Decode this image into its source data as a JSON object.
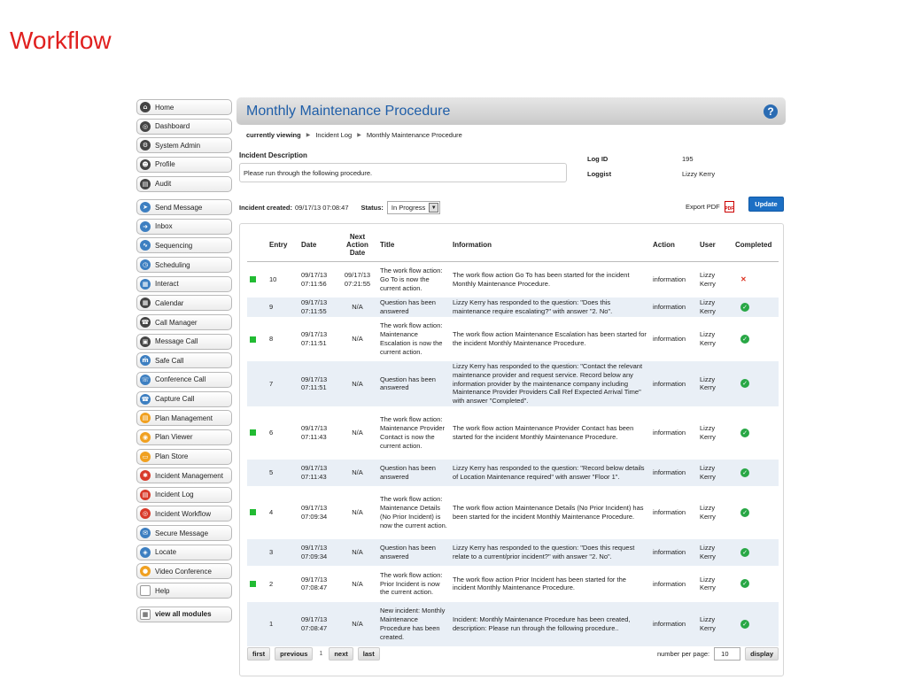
{
  "slide_title": "Workflow",
  "sidebar": {
    "group1": [
      {
        "label": "Home",
        "icon": "home-icon",
        "color": "dark",
        "glyph": "⌂"
      },
      {
        "label": "Dashboard",
        "icon": "dashboard-icon",
        "color": "dark",
        "glyph": "◎"
      },
      {
        "label": "System Admin",
        "icon": "gear-icon",
        "color": "dark",
        "glyph": "⚙"
      },
      {
        "label": "Profile",
        "icon": "user-icon",
        "color": "dark",
        "glyph": "☻"
      },
      {
        "label": "Audit",
        "icon": "audit-icon",
        "color": "dark",
        "glyph": "▤"
      }
    ],
    "group2": [
      {
        "label": "Send Message",
        "icon": "send-icon",
        "color": "blue",
        "glyph": "➤"
      },
      {
        "label": "Inbox",
        "icon": "inbox-icon",
        "color": "blue",
        "glyph": "➜"
      },
      {
        "label": "Sequencing",
        "icon": "sequencing-icon",
        "color": "blue",
        "glyph": "∿"
      },
      {
        "label": "Scheduling",
        "icon": "clock-icon",
        "color": "blue",
        "glyph": "◷"
      },
      {
        "label": "Interact",
        "icon": "interact-icon",
        "color": "blue",
        "glyph": "▦"
      },
      {
        "label": "Calendar",
        "icon": "calendar-icon",
        "color": "dark",
        "glyph": "▦"
      },
      {
        "label": "Call Manager",
        "icon": "phone-icon",
        "color": "dark",
        "glyph": "☎"
      },
      {
        "label": "Message Call",
        "icon": "message-call-icon",
        "color": "dark",
        "glyph": "▣"
      },
      {
        "label": "Safe Call",
        "icon": "safe-call-icon",
        "color": "blue",
        "glyph": "ṁ"
      },
      {
        "label": "Conference Call",
        "icon": "conference-icon",
        "color": "blue",
        "glyph": "☏"
      },
      {
        "label": "Capture Call",
        "icon": "capture-icon",
        "color": "blue",
        "glyph": "☎"
      },
      {
        "label": "Plan Management",
        "icon": "plan-management-icon",
        "color": "orange",
        "glyph": "▤"
      },
      {
        "label": "Plan Viewer",
        "icon": "plan-viewer-icon",
        "color": "orange",
        "glyph": "◉"
      },
      {
        "label": "Plan Store",
        "icon": "plan-store-icon",
        "color": "orange",
        "glyph": "▭"
      },
      {
        "label": "Incident Management",
        "icon": "incident-management-icon",
        "color": "red",
        "glyph": "✱"
      },
      {
        "label": "Incident Log",
        "icon": "incident-log-icon",
        "color": "red",
        "glyph": "▤"
      },
      {
        "label": "Incident Workflow",
        "icon": "incident-workflow-icon",
        "color": "red",
        "glyph": "◎"
      },
      {
        "label": "Secure Message",
        "icon": "secure-message-icon",
        "color": "blue",
        "glyph": "✉"
      },
      {
        "label": "Locate",
        "icon": "locate-icon",
        "color": "blue",
        "glyph": "◈"
      },
      {
        "label": "Video Conference",
        "icon": "video-conference-icon",
        "color": "orange",
        "glyph": "●"
      },
      {
        "label": "Help",
        "icon": "help-square-icon",
        "color": "white",
        "glyph": ""
      }
    ],
    "view_all": "view all modules"
  },
  "header": {
    "title": "Monthly Maintenance Procedure",
    "help_glyph": "?"
  },
  "breadcrumb": {
    "prefix": "currently viewing",
    "items": [
      "Incident Log",
      "Monthly Maintenance Procedure"
    ]
  },
  "incident": {
    "desc_label": "Incident Description",
    "desc_value": "Please run through the following procedure.",
    "log_id_label": "Log ID",
    "log_id_value": "195",
    "loggist_label": "Loggist",
    "loggist_value": "Lizzy Kerry",
    "created_label": "Incident created:",
    "created_value": "09/17/13 07:08:47",
    "status_label": "Status:",
    "status_value": "In Progress",
    "export_label": "Export PDF",
    "update_label": "Update"
  },
  "table": {
    "headers": [
      "",
      "Entry",
      "Date",
      "Next Action Date",
      "Title",
      "Information",
      "Action",
      "User",
      "Completed"
    ],
    "rows": [
      {
        "flag": true,
        "entry": "10",
        "date": "09/17/13 07:11:56",
        "next": "09/17/13 07:21:55",
        "title": "The work flow action: Go To is now the current action.",
        "info": "The work flow action Go To has been started for the incident Monthly Maintenance Procedure.",
        "action": "information",
        "user": "Lizzy Kerry",
        "done": false
      },
      {
        "flag": false,
        "entry": "9",
        "date": "09/17/13 07:11:55",
        "next": "N/A",
        "title": "Question has been answered",
        "info": "Lizzy Kerry has responded to the question: \"Does this maintenance require escalating?\" with answer \"2. No\".",
        "action": "information",
        "user": "Lizzy Kerry",
        "done": true
      },
      {
        "flag": true,
        "entry": "8",
        "date": "09/17/13 07:11:51",
        "next": "N/A",
        "title": "The work flow action: Maintenance Escalation is now the current action.",
        "info": "The work flow action Maintenance Escalation has been started for the incident Monthly Maintenance Procedure.",
        "action": "information",
        "user": "Lizzy Kerry",
        "done": true
      },
      {
        "flag": false,
        "entry": "7",
        "date": "09/17/13 07:11:51",
        "next": "N/A",
        "title": "Question has been answered",
        "info": "Lizzy Kerry has responded to the question: \"Contact the relevant maintenance provider and request service. Record below any information provider by the maintenance company including Maintenance Provider Providers Call Ref Expected Arrival Time\" with answer \"Completed\".",
        "action": "information",
        "user": "Lizzy Kerry",
        "done": true
      },
      {
        "flag": true,
        "entry": "6",
        "date": "09/17/13 07:11:43",
        "next": "N/A",
        "title": "The work flow action: Maintenance Provider Contact is now the current action.",
        "info": "The work flow action Maintenance Provider Contact has been started for the incident Monthly Maintenance Procedure.",
        "action": "information",
        "user": "Lizzy Kerry",
        "done": true
      },
      {
        "flag": false,
        "entry": "5",
        "date": "09/17/13 07:11:43",
        "next": "N/A",
        "title": "Question has been answered",
        "info": "Lizzy Kerry has responded to the question: \"Record below details of Location Maintenance required\" with answer \"Floor 1\".",
        "action": "information",
        "user": "Lizzy Kerry",
        "done": true
      },
      {
        "flag": true,
        "entry": "4",
        "date": "09/17/13 07:09:34",
        "next": "N/A",
        "title": "The work flow action: Maintenance Details (No Prior Incident) is now the current action.",
        "info": "The work flow action Maintenance Details (No Prior Incident) has been started for the incident Monthly Maintenance Procedure.",
        "action": "information",
        "user": "Lizzy Kerry",
        "done": true
      },
      {
        "flag": false,
        "entry": "3",
        "date": "09/17/13 07:09:34",
        "next": "N/A",
        "title": "Question has been answered",
        "info": "Lizzy Kerry has responded to the question: \"Does this request relate to a current/prior incident?\" with answer \"2. No\".",
        "action": "information",
        "user": "Lizzy Kerry",
        "done": true
      },
      {
        "flag": true,
        "entry": "2",
        "date": "09/17/13 07:08:47",
        "next": "N/A",
        "title": "The work flow action: Prior Incident is now the current action.",
        "info": "The work flow action Prior Incident has been started for the incident Monthly Maintenance Procedure.",
        "action": "information",
        "user": "Lizzy Kerry",
        "done": true
      },
      {
        "flag": false,
        "entry": "1",
        "date": "09/17/13 07:08:47",
        "next": "N/A",
        "title": "New incident: Monthly Maintenance Procedure has been created.",
        "info": "Incident: Monthly Maintenance Procedure has been created, description: Please run through the following procedure..",
        "action": "information",
        "user": "Lizzy Kerry",
        "done": true
      }
    ]
  },
  "pager": {
    "first": "first",
    "previous": "previous",
    "current": "1",
    "next": "next",
    "last": "last",
    "per_page_label": "number per page:",
    "per_page_value": "10",
    "display": "display"
  },
  "colors": {
    "title_red": "#e0201f",
    "header_blue": "#1f5ea8",
    "update_blue": "#1c6fc4",
    "flag_green": "#22bb33",
    "row_alt": "#e9eff6"
  }
}
